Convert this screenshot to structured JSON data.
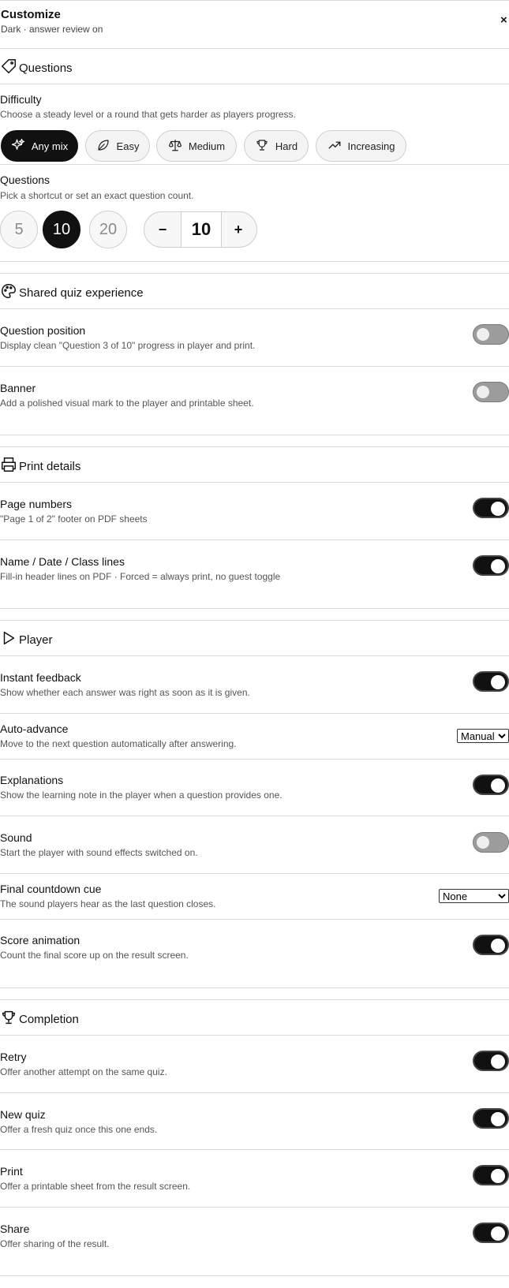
{
  "header": {
    "title": "Customize",
    "subtitle": "Dark · answer review on",
    "close_label": "×"
  },
  "sections": {
    "questions": {
      "title": "Questions"
    },
    "shared": {
      "title": "Shared quiz experience"
    },
    "print": {
      "title": "Print details"
    },
    "player": {
      "title": "Player"
    },
    "completion": {
      "title": "Completion"
    }
  },
  "difficulty": {
    "label": "Difficulty",
    "description": "Choose a steady level or a round that gets harder as players progress.",
    "options": [
      "Any mix",
      "Easy",
      "Medium",
      "Hard",
      "Increasing"
    ],
    "selected": "Any mix"
  },
  "question_count": {
    "label": "Questions",
    "description": "Pick a shortcut or set an exact question count.",
    "shortcuts": [
      "5",
      "10",
      "20"
    ],
    "selected": "10",
    "minus": "−",
    "plus": "+",
    "value": "10"
  },
  "settings": {
    "question_position": {
      "label": "Question position",
      "description": "Display clean \"Question 3 of 10\" progress in player and print.",
      "on": false
    },
    "banner": {
      "label": "Banner",
      "description": "Add a polished visual mark to the player and printable sheet.",
      "on": false
    },
    "page_numbers": {
      "label": "Page numbers",
      "description": "\"Page 1 of 2\" footer on PDF sheets",
      "on": true
    },
    "name_lines": {
      "label": "Name / Date / Class lines",
      "description": "Fill-in header lines on PDF · Forced = always print, no guest toggle",
      "on": true
    },
    "instant_feedback": {
      "label": "Instant feedback",
      "description": "Show whether each answer was right as soon as it is given.",
      "on": true
    },
    "auto_advance": {
      "label": "Auto-advance",
      "description": "Move to the next question automatically after answering.",
      "value": "Manual"
    },
    "explanations": {
      "label": "Explanations",
      "description": "Show the learning note in the player when a question provides one.",
      "on": true
    },
    "sound": {
      "label": "Sound",
      "description": "Start the player with sound effects switched on.",
      "on": false
    },
    "countdown_cue": {
      "label": "Final countdown cue",
      "description": "The sound players hear as the last question closes.",
      "value": "None"
    },
    "score_animation": {
      "label": "Score animation",
      "description": "Count the final score up on the result screen.",
      "on": true
    },
    "retry": {
      "label": "Retry",
      "description": "Offer another attempt on the same quiz.",
      "on": true
    },
    "new_quiz": {
      "label": "New quiz",
      "description": "Offer a fresh quiz once this one ends.",
      "on": true
    },
    "print": {
      "label": "Print",
      "description": "Offer a printable sheet from the result screen.",
      "on": true
    },
    "share": {
      "label": "Share",
      "description": "Offer sharing of the result.",
      "on": true
    }
  }
}
